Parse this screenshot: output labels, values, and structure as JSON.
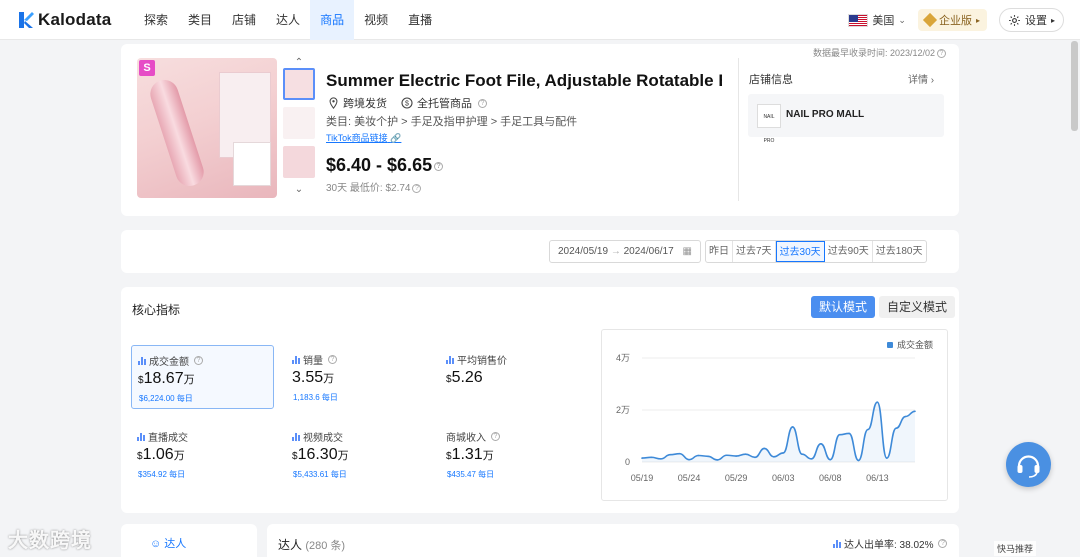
{
  "app": {
    "name": "Kalodata"
  },
  "nav": {
    "items": [
      "探索",
      "类目",
      "店铺",
      "达人",
      "商品",
      "视频",
      "直播"
    ],
    "active_index": 4
  },
  "top_right": {
    "language": "美国",
    "enterprise": "企业版",
    "settings": "设置"
  },
  "product": {
    "collect_time": "数据最早收录时间: 2023/12/02",
    "badge": "S",
    "title": "Summer Electric Foot File, Adjustable Rotatable El...",
    "tags": [
      "跨境发货",
      "全托管商品"
    ],
    "category": "类目: 美妆个护 > 手足及指甲护理 > 手足工具与配件",
    "link": "TikTok商品链接",
    "price": "$6.40 - $6.65",
    "lowest": "30天 最低价: $2.74"
  },
  "shop": {
    "header": "店铺信息",
    "detail": "详情",
    "name": "NAIL PRO MALL",
    "logo_text": "NAIL PRO"
  },
  "date_filter": {
    "start": "2024/05/19",
    "end": "2024/06/17",
    "tabs": [
      "昨日",
      "过去7天",
      "过去30天",
      "过去90天",
      "过去180天"
    ],
    "active_index": 2
  },
  "metrics": {
    "title": "核心指标",
    "modes": [
      "默认模式",
      "自定义模式"
    ],
    "active_mode": 0,
    "items": [
      {
        "label": "成交金额",
        "cur": "$",
        "value": "18.67",
        "unit": "万",
        "sub": "$6,224.00 每日"
      },
      {
        "label": "销量",
        "cur": "",
        "value": "3.55",
        "unit": "万",
        "sub": "1,183.6 每日"
      },
      {
        "label": "平均销售价",
        "cur": "$",
        "value": "5.26",
        "unit": "",
        "sub": ""
      },
      {
        "label": "直播成交",
        "cur": "$",
        "value": "1.06",
        "unit": "万",
        "sub": "$354.92 每日"
      },
      {
        "label": "视频成交",
        "cur": "$",
        "value": "16.30",
        "unit": "万",
        "sub": "$5,433.61 每日"
      },
      {
        "label": "商城收入",
        "cur": "$",
        "value": "1.31",
        "unit": "万",
        "sub": "$435.47 每日"
      }
    ]
  },
  "chart_data": {
    "type": "area",
    "title": "",
    "legend": [
      "成交金额"
    ],
    "legend_position": "top-right",
    "color": "#3e8ad8",
    "y_ticks": [
      "4万",
      "2万",
      "0"
    ],
    "ylim": [
      0,
      40000
    ],
    "x_ticks": [
      "05/19",
      "05/24",
      "05/29",
      "06/03",
      "06/08",
      "06/13"
    ],
    "x": [
      "05/19",
      "05/20",
      "05/21",
      "05/22",
      "05/23",
      "05/24",
      "05/25",
      "05/26",
      "05/27",
      "05/28",
      "05/29",
      "05/30",
      "05/31",
      "06/01",
      "06/02",
      "06/03",
      "06/04",
      "06/05",
      "06/06",
      "06/07",
      "06/08",
      "06/09",
      "06/10",
      "06/11",
      "06/12",
      "06/13",
      "06/14",
      "06/15",
      "06/16",
      "06/17"
    ],
    "series": [
      {
        "name": "成交金额",
        "values": [
          1500,
          1800,
          1200,
          2800,
          3200,
          900,
          2500,
          2200,
          800,
          2600,
          2300,
          3000,
          1800,
          5200,
          2000,
          3500,
          13500,
          3000,
          1200,
          7000,
          900,
          10500,
          11000,
          600,
          12500,
          23000,
          1500,
          13000,
          17500,
          19500
        ]
      }
    ]
  },
  "talent": {
    "left_tab": "达人",
    "title": "达人",
    "count": "(280 条)",
    "rate": "达人出单率: 38.02%"
  },
  "watermark": {
    "text": "大数跨境",
    "corner": "快马推荐"
  }
}
